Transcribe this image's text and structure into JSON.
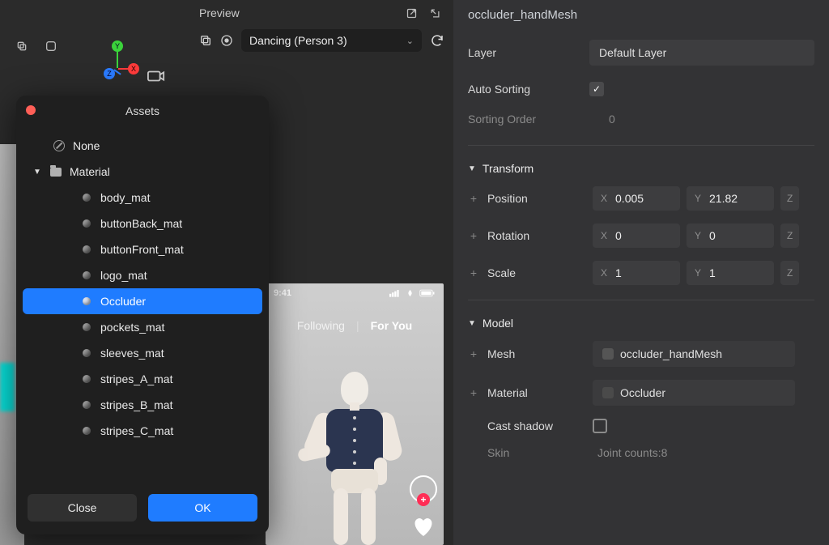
{
  "preview": {
    "title": "Preview",
    "animation_selected": "Dancing (Person 3)"
  },
  "phone": {
    "time": "9:41",
    "tabs": {
      "following": "Following",
      "foryou": "For You"
    }
  },
  "assets_modal": {
    "title": "Assets",
    "none_label": "None",
    "material_group": "Material",
    "items": [
      "body_mat",
      "buttonBack_mat",
      "buttonFront_mat",
      "logo_mat",
      "Occluder",
      "pockets_mat",
      "sleeves_mat",
      "stripes_A_mat",
      "stripes_B_mat",
      "stripes_C_mat"
    ],
    "selected_index": 4,
    "close": "Close",
    "ok": "OK"
  },
  "inspector": {
    "object_name": "occluder_handMesh",
    "layer_label": "Layer",
    "layer_value": "Default Layer",
    "auto_sorting_label": "Auto Sorting",
    "auto_sorting": true,
    "sorting_order_label": "Sorting Order",
    "sorting_order": "0",
    "transform": {
      "title": "Transform",
      "position_label": "Position",
      "position": {
        "x": "0.005",
        "y": "21.82",
        "z": ""
      },
      "rotation_label": "Rotation",
      "rotation": {
        "x": "0",
        "y": "0",
        "z": ""
      },
      "scale_label": "Scale",
      "scale": {
        "x": "1",
        "y": "1",
        "z": ""
      },
      "ax": {
        "x": "X",
        "y": "Y",
        "z": "Z"
      }
    },
    "model": {
      "title": "Model",
      "mesh_label": "Mesh",
      "mesh_value": "occluder_handMesh",
      "material_label": "Material",
      "material_value": "Occluder",
      "cast_shadow_label": "Cast shadow",
      "cast_shadow": false,
      "skin_label": "Skin",
      "skin_value": "Joint counts:8"
    }
  }
}
